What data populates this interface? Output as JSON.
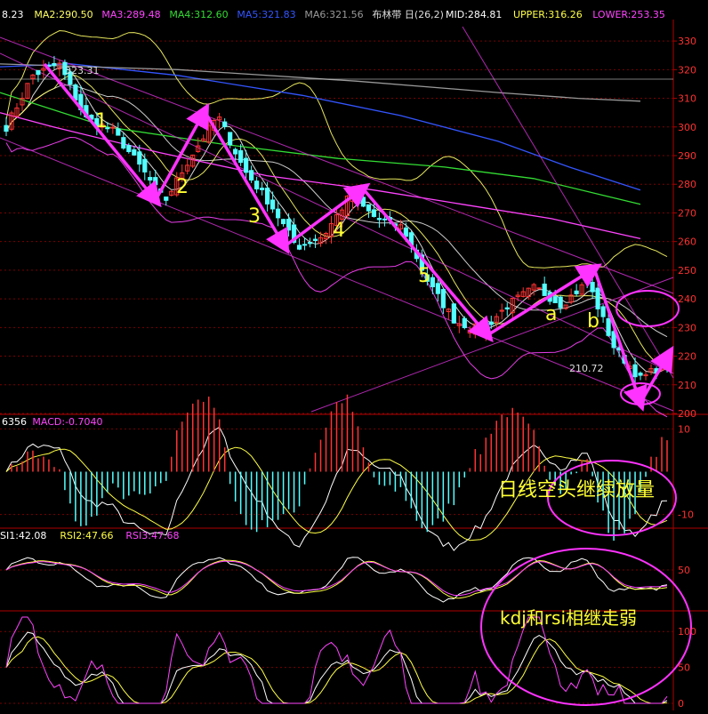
{
  "header": {
    "items": [
      {
        "text": "8.23",
        "color": "#ffffff"
      },
      {
        "text": "MA2:290.50",
        "color": "#ffff66"
      },
      {
        "text": "MA3:289.48",
        "color": "#ff44ff"
      },
      {
        "text": "MA4:312.60",
        "color": "#33dd33"
      },
      {
        "text": "MA5:321.83",
        "color": "#3355ff"
      },
      {
        "text": "MA6:321.56",
        "color": "#999999"
      },
      {
        "text": "布林带 日(26,2)",
        "color": "#dddddd"
      },
      {
        "text": "MID:284.81",
        "color": "#ffffff"
      },
      {
        "text": "UPPER:316.26",
        "color": "#ffff44"
      },
      {
        "text": "LOWER:253.35",
        "color": "#ff44ff"
      }
    ]
  },
  "macd_header": [
    {
      "text": "6356",
      "color": "#ffffff"
    },
    {
      "text": "MACD:-0.7040",
      "color": "#ff44ff"
    }
  ],
  "rsi_header": [
    {
      "text": "SI1:42.08",
      "color": "#ffffff"
    },
    {
      "text": "RSI2:47.66",
      "color": "#ffff44"
    },
    {
      "text": "RSI3:47.68",
      "color": "#ff44ff"
    }
  ],
  "annotations": {
    "high_label": "323.31",
    "low_label": "210.72",
    "wave_labels": [
      "1",
      "2",
      "3",
      "4",
      "5",
      "a",
      "b"
    ],
    "macd_note": "日线空头继续放量",
    "kdj_note": "kdj和rsi相继走弱"
  },
  "colors": {
    "up": "#ff3333",
    "down": "#54ffff",
    "grid": "#7a0000",
    "axis": "#b00000",
    "axis_text": "#ff3030",
    "arrow": "#ff33ff",
    "label": "#ffff33"
  },
  "chart_data": [
    {
      "type": "candlestick",
      "panel": "price",
      "ylim": [
        200,
        335
      ],
      "y_ticks": [
        200,
        210,
        220,
        230,
        240,
        250,
        260,
        270,
        280,
        290,
        300,
        310,
        320,
        330
      ],
      "waypoints": [
        300,
        318,
        322,
        303,
        299,
        287,
        274,
        290,
        304,
        285,
        273,
        258,
        262,
        276,
        268,
        265,
        245,
        232,
        229,
        238,
        244,
        238,
        246,
        223,
        212,
        218
      ],
      "high": 323.31,
      "low": 210.72
    },
    {
      "type": "histogram",
      "panel": "MACD",
      "y_ticks": [
        10,
        -10
      ],
      "ylim": [
        -13,
        13
      ]
    },
    {
      "type": "line",
      "panel": "RSI",
      "y_ticks": [
        50
      ],
      "ylim": [
        0,
        100
      ]
    },
    {
      "type": "line",
      "panel": "KDJ",
      "y_ticks": [
        100,
        50,
        0
      ],
      "ylim": [
        -5,
        125
      ]
    }
  ]
}
